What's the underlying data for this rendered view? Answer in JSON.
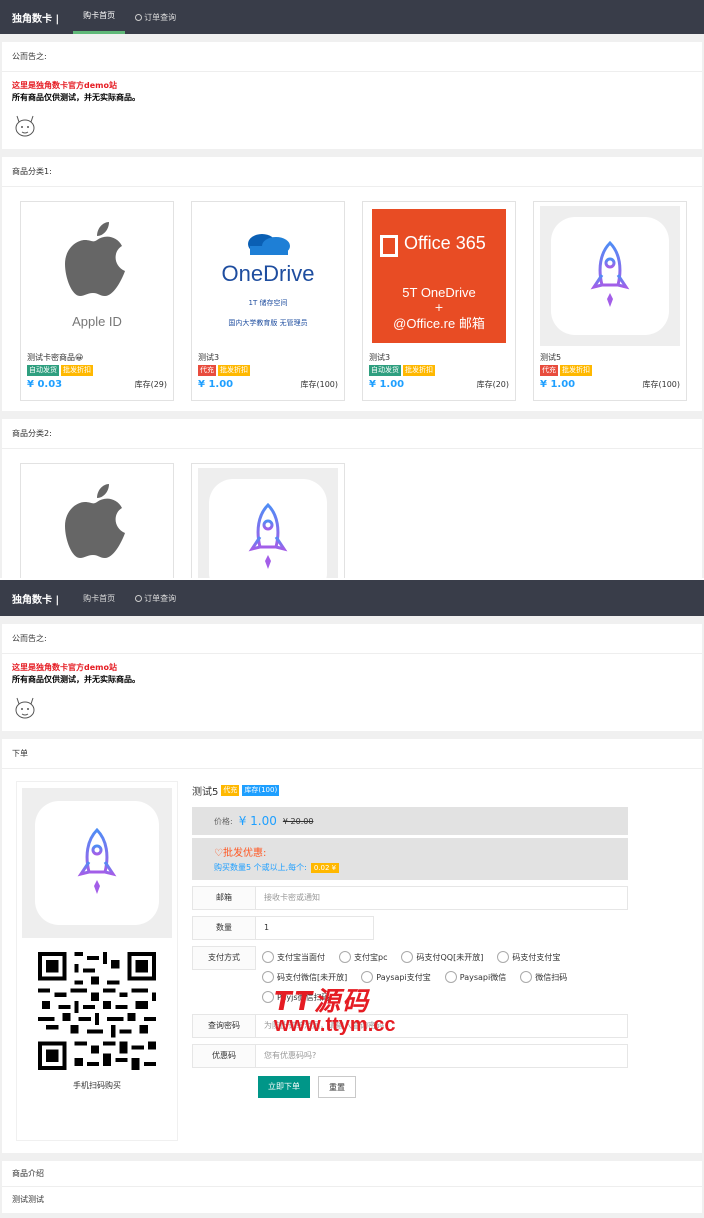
{
  "nav": {
    "brand": "独角数卡 |",
    "home": "购卡首页",
    "order_query": "订单查询"
  },
  "notice": {
    "title": "公而告之:",
    "line_red": "这里是独角数卡官方demo站",
    "line_black": "所有商品仅供测试，并无实际商品。"
  },
  "category1": {
    "title": "商品分类1:",
    "products": [
      {
        "name": "测试卡密商品😀",
        "tags": [
          "自动发货",
          "批发折扣"
        ],
        "tag_colors": [
          "green",
          "orange"
        ],
        "price": "¥ 0.03",
        "stock": "库存(29)",
        "image": "apple-id"
      },
      {
        "name": "测试3",
        "tags": [
          "代充",
          "批发折扣"
        ],
        "tag_colors": [
          "red",
          "orange"
        ],
        "price": "¥ 1.00",
        "stock": "库存(100)",
        "image": "onedrive"
      },
      {
        "name": "测试3",
        "tags": [
          "自动发货",
          "批发折扣"
        ],
        "tag_colors": [
          "green",
          "orange"
        ],
        "price": "¥ 1.00",
        "stock": "库存(20)",
        "image": "office365"
      },
      {
        "name": "测试5",
        "tags": [
          "代充",
          "批发折扣"
        ],
        "tag_colors": [
          "red",
          "orange"
        ],
        "price": "¥ 1.00",
        "stock": "库存(100)",
        "image": "rocket"
      }
    ]
  },
  "category2": {
    "title": "商品分类2:"
  },
  "images": {
    "apple_label": "Apple ID",
    "onedrive_title": "OneDrive",
    "onedrive_sub1": "1T 储存空间",
    "onedrive_sub2": "国内大学教育版 无管理员",
    "o365_title": "Office 365",
    "o365_line1": "5T  OneDrive",
    "o365_line2": "+",
    "o365_line3": "@Office.re 邮箱"
  },
  "order": {
    "section_title": "下单",
    "product_name": "测试5",
    "badge_type": "代充",
    "badge_stock": "库存(100)",
    "price_label": "价格:",
    "price": "¥ 1.00",
    "price_old": "¥ 20.00",
    "discount_title": "♡批发优惠:",
    "discount_text": "购买数量5 个或以上,每个:",
    "discount_price": "0.02 ¥",
    "email_label": "邮箱",
    "email_placeholder": "接收卡密或通知",
    "qty_label": "数量",
    "qty_value": "1",
    "pay_label": "支付方式",
    "pay_options": [
      "支付宝当面付",
      "支付宝pc",
      "码支付QQ[未开放]",
      "码支付支付宝",
      "码支付微信[未开放]",
      "Paysapi支付宝",
      "Paysapi微信",
      "微信扫码",
      "Payjs微信扫码"
    ],
    "password_label": "查询密码",
    "password_placeholder": "为防止订单泄漏，请输入查询密码",
    "coupon_label": "优惠码",
    "coupon_placeholder": "您有优惠码吗?",
    "submit": "立即下单",
    "reset": "重置",
    "qr_caption": "手机扫码购买"
  },
  "watermark": {
    "text": "TT源码",
    "url": "www.ttym.cc"
  },
  "intro": {
    "title": "商品介绍",
    "body": "测试测试"
  }
}
